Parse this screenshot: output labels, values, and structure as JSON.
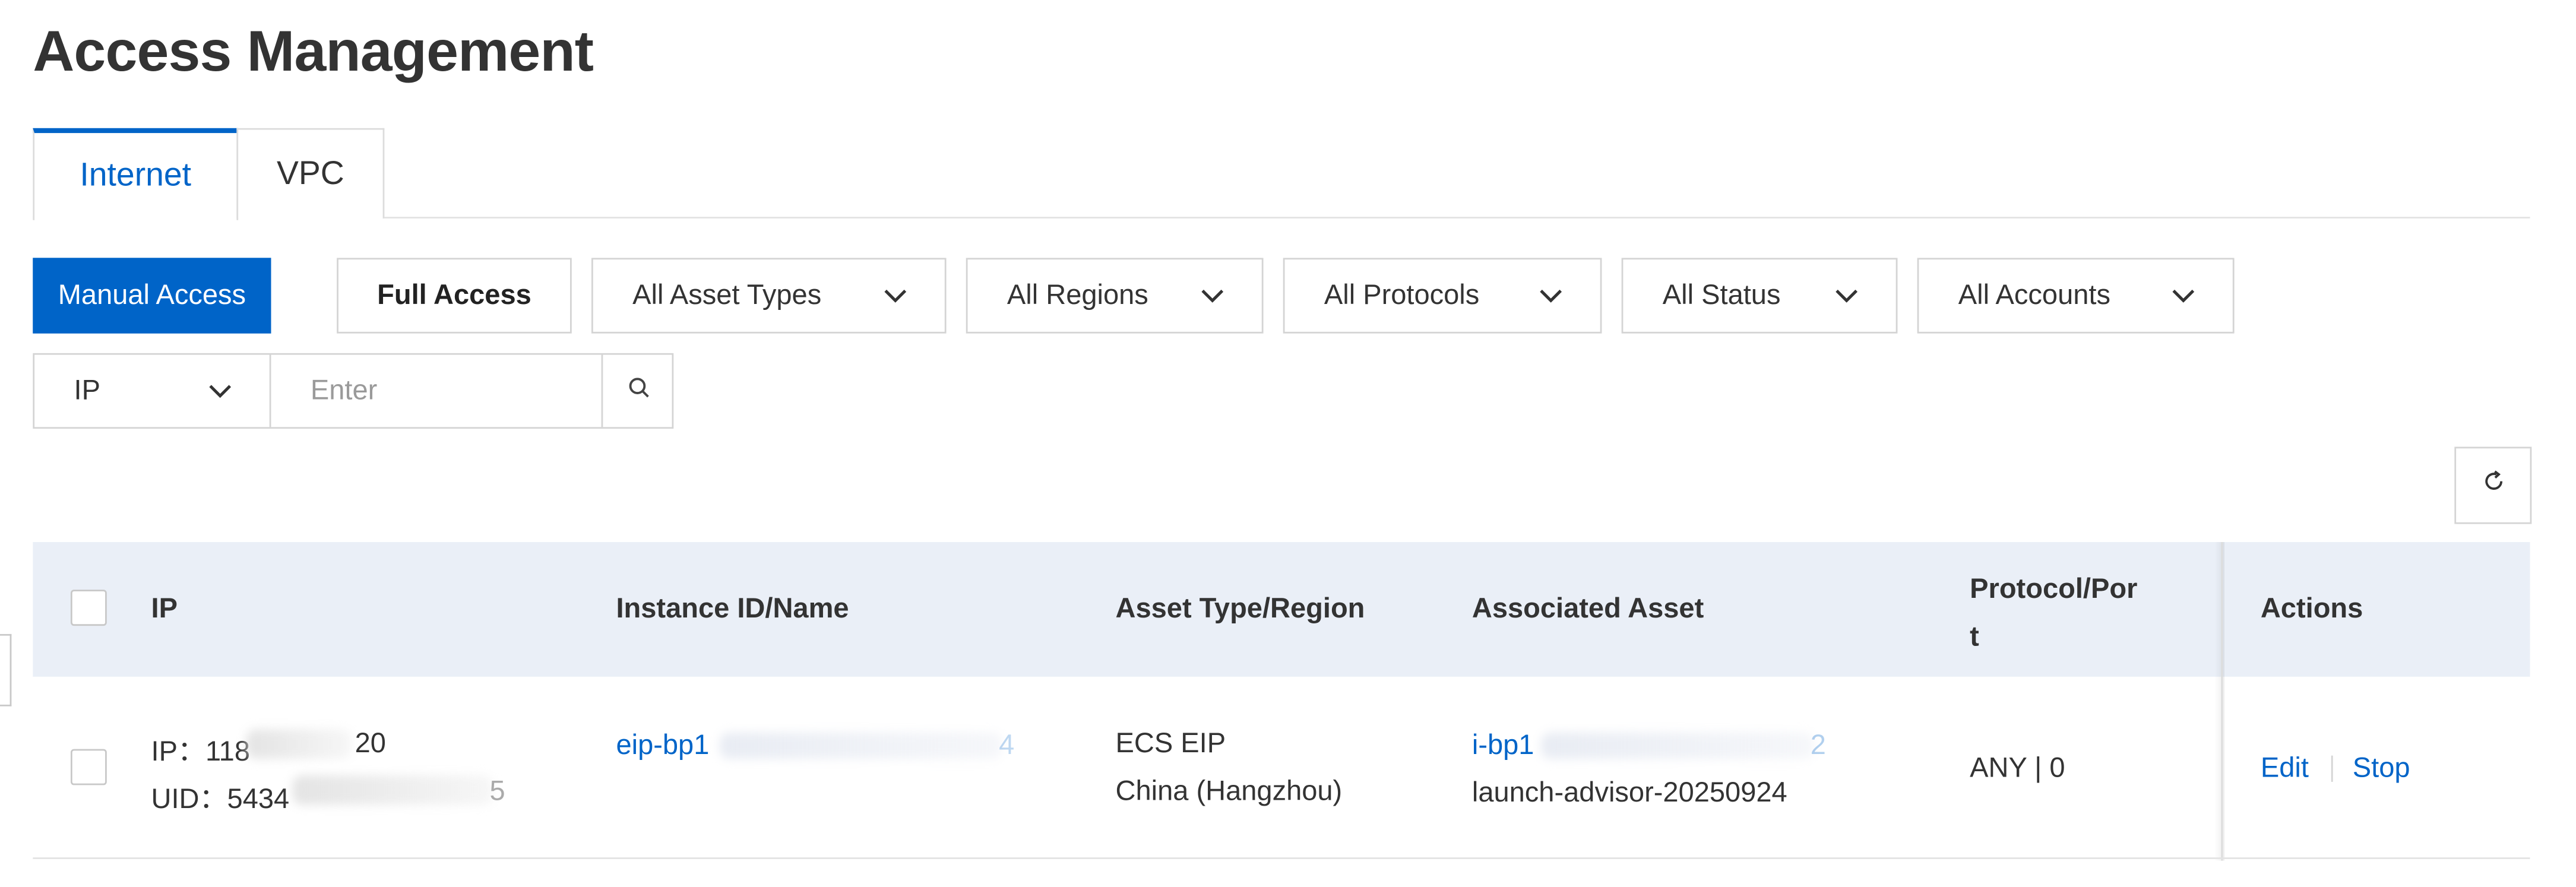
{
  "page": {
    "title": "Access Management"
  },
  "tabs": [
    {
      "label": "Internet",
      "active": true
    },
    {
      "label": "VPC",
      "active": false
    }
  ],
  "toolbar": {
    "manual_access": "Manual Access",
    "full_access": "Full Access",
    "filters": [
      "All Asset Types",
      "All Regions",
      "All Protocols",
      "All Status",
      "All Accounts"
    ]
  },
  "search": {
    "field": "IP",
    "placeholder": "Enter",
    "value": ""
  },
  "table": {
    "columns": [
      "IP",
      "Instance ID/Name",
      "Asset Type/Region",
      "Associated Asset",
      "Protocol/Por",
      "t",
      "Actions"
    ],
    "rows": [
      {
        "ip_line": "IP：118",
        "ip_suffix": "20",
        "uid_line": "UID：5434",
        "uid_suffix": "5",
        "instance_id": "eip-bp1",
        "instance_suffix": "4",
        "asset_type": "ECS EIP",
        "region": "China (Hangzhou)",
        "associated_asset_id": "i-bp1",
        "associated_asset_suffix": "2",
        "associated_asset_name": "launch-advisor-20250924",
        "protocol_port": "ANY | 0",
        "actions": [
          "Edit",
          "Stop"
        ]
      }
    ]
  },
  "colors": {
    "accent": "#0064c8",
    "header_bg": "#eaeff7",
    "border": "#d4d4d4"
  },
  "icons": {
    "dropdown": "chevron-down-icon",
    "search": "search-icon",
    "refresh": "refresh-icon"
  }
}
